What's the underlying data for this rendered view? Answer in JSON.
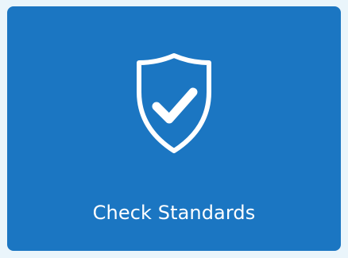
{
  "card": {
    "label": "Check Standards",
    "icon": "shield-check-icon",
    "background_color": "#1b76c2",
    "page_background_color": "#eaf5fb",
    "foreground_color": "#ffffff"
  }
}
